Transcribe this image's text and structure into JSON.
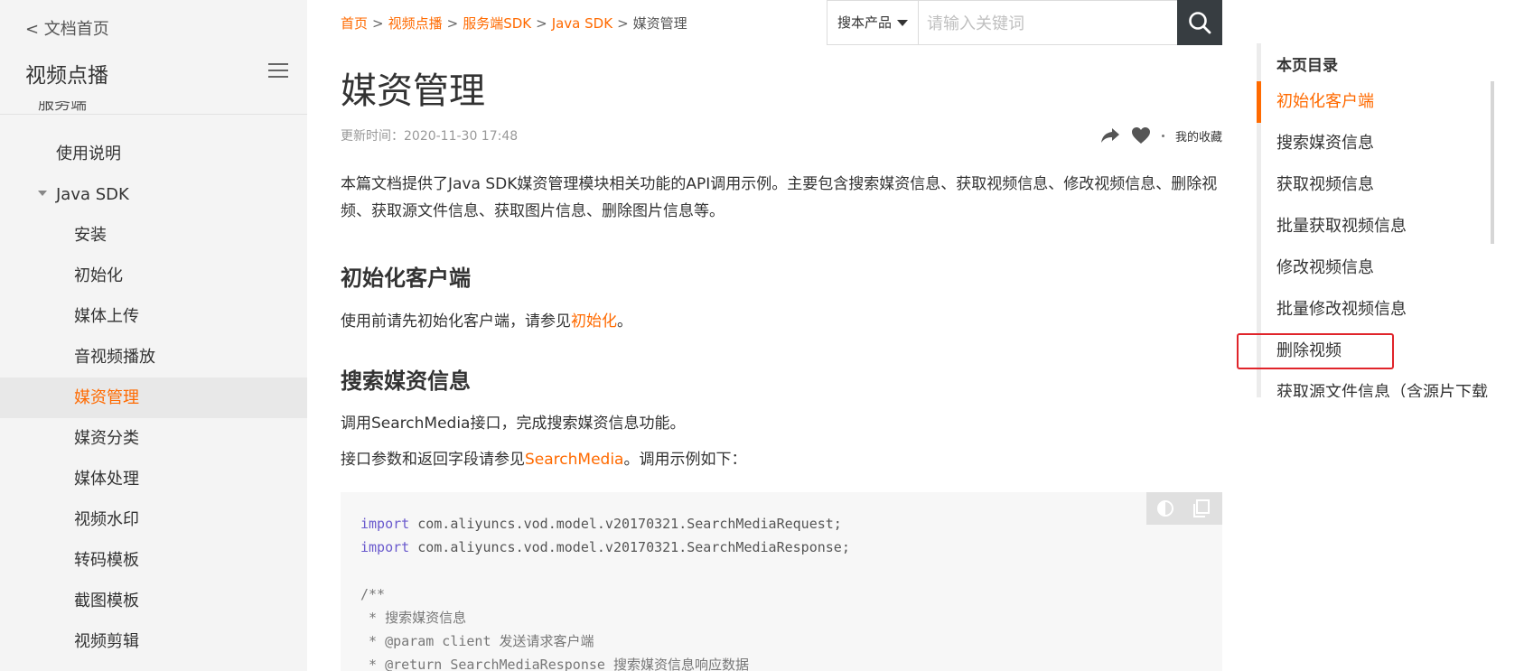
{
  "sidebar": {
    "back_label": "< 文档首页",
    "product_title": "视频点播",
    "clipped_item": "服务端",
    "items": [
      {
        "label": "使用说明",
        "level": 1,
        "expanded": false
      },
      {
        "label": "Java SDK",
        "level": 1,
        "expanded": true
      },
      {
        "label": "安装",
        "level": 2
      },
      {
        "label": "初始化",
        "level": 2
      },
      {
        "label": "媒体上传",
        "level": 2
      },
      {
        "label": "音视频播放",
        "level": 2
      },
      {
        "label": "媒资管理",
        "level": 2,
        "active": true
      },
      {
        "label": "媒资分类",
        "level": 2
      },
      {
        "label": "媒体处理",
        "level": 2
      },
      {
        "label": "视频水印",
        "level": 2
      },
      {
        "label": "转码模板",
        "level": 2
      },
      {
        "label": "截图模板",
        "level": 2
      },
      {
        "label": "视频剪辑",
        "level": 2
      }
    ]
  },
  "breadcrumb": {
    "items": [
      "首页",
      "视频点播",
      "服务端SDK",
      "Java SDK"
    ],
    "current": "媒资管理",
    "separator": ">"
  },
  "search": {
    "product_label": "搜本产品",
    "placeholder": "请输入关键词",
    "value": "",
    "button_icon": "search-icon"
  },
  "article": {
    "title": "媒资管理",
    "updated": "更新时间：2020-11-30 17:48",
    "favorites_label": "我的收藏",
    "intro": "本篇文档提供了Java SDK媒资管理模块相关功能的API调用示例。主要包含搜索媒资信息、获取视频信息、修改视频信息、删除视频、获取源文件信息、获取图片信息、删除图片信息等。",
    "sections": [
      {
        "heading": "初始化客户端",
        "para_prefix": "使用前请先初始化客户端，请参见",
        "para_link": "初始化",
        "para_suffix": "。"
      },
      {
        "heading": "搜索媒资信息",
        "para1": "调用SearchMedia接口，完成搜索媒资信息功能。",
        "para2_prefix": "接口参数和返回字段请参见",
        "para2_link": "SearchMedia",
        "para2_suffix": "。调用示例如下："
      }
    ],
    "code": {
      "lines": [
        {
          "kw": "import",
          "text": " com.aliyuncs.vod.model.v20170321.SearchMediaRequest;"
        },
        {
          "kw": "import",
          "text": " com.aliyuncs.vod.model.v20170321.SearchMediaResponse;"
        },
        {
          "kw": "",
          "text": ""
        },
        {
          "kw": "",
          "text": "/**"
        },
        {
          "kw": "",
          "text": " * 搜索媒资信息"
        },
        {
          "kw": "",
          "text": " * @param client 发送请求客户端"
        },
        {
          "kw": "",
          "text": " * @return SearchMediaResponse 搜索媒资信息响应数据"
        }
      ]
    }
  },
  "toc": {
    "title": "本页目录",
    "items": [
      {
        "label": "初始化客户端",
        "active": true
      },
      {
        "label": "搜索媒资信息"
      },
      {
        "label": "获取视频信息"
      },
      {
        "label": "批量获取视频信息"
      },
      {
        "label": "修改视频信息"
      },
      {
        "label": "批量修改视频信息"
      },
      {
        "label": "删除视频",
        "highlighted": true
      },
      {
        "label": "获取源文件信息（含源片下载"
      }
    ]
  },
  "colors": {
    "accent": "#ff6a00",
    "highlight_box": "#e0242a",
    "search_button": "#373d41",
    "sidebar_bg": "#f4f4f4"
  }
}
